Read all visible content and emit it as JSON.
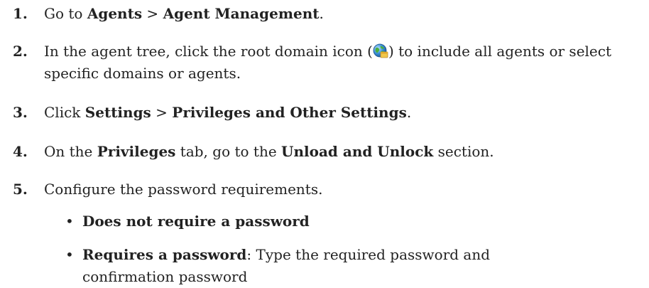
{
  "steps": [
    {
      "num": "1.",
      "parts": [
        "Go to ",
        "Agents",
        " > ",
        "Agent Management",
        "."
      ]
    },
    {
      "num": "2.",
      "before_icon": "In the agent tree, click the root domain icon (",
      "after_icon": ") to include all agents or select specific domains or agents.",
      "icon": "root-domain-icon"
    },
    {
      "num": "3.",
      "parts": [
        "Click ",
        "Settings",
        " > ",
        "Privileges and Other Settings",
        "."
      ]
    },
    {
      "num": "4.",
      "parts": [
        "On the ",
        "Privileges",
        " tab, go to the ",
        "Unload and Unlock",
        " section."
      ]
    },
    {
      "num": "5.",
      "text": "Configure the password requirements."
    }
  ],
  "options": [
    {
      "bullet": "•",
      "label": "Does not require a password",
      "detail": ""
    },
    {
      "bullet": "•",
      "label": "Requires a password",
      "detail": ": Type the required password and confirmation password"
    }
  ]
}
